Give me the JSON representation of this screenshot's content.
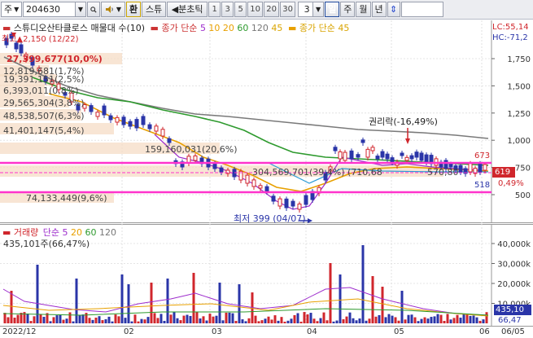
{
  "toolbar": {
    "market": "주",
    "code": "204630",
    "btn_unit": "환",
    "btn_stock": "스튜",
    "btn_minute": "◀분초틱",
    "periods": [
      "1",
      "3",
      "5",
      "10",
      "20",
      "30"
    ],
    "count": "3",
    "btn_day": "일",
    "btn_week": "주",
    "btn_month": "월",
    "btn_year": "년"
  },
  "main_legend": {
    "title": "스튜디오산타클로스 매물대 수(10)",
    "ma_label": "종가 단순",
    "ma_periods": [
      "5",
      "10",
      "20",
      "60",
      "120",
      "45"
    ],
    "ma_colors": [
      "#9d2ccc",
      "#e8a000",
      "#e8a000",
      "#2e9a2e",
      "#777777",
      "#d9a400"
    ],
    "extra_label": "종가 단순 45",
    "lc": "LC:55,14",
    "hc": "HC:-71,2"
  },
  "price_labels": {
    "high": "▲2,150 (12/22)",
    "high_prefix": "최고",
    "low": "최저 399 (04/07)",
    "rights": "권리락(-16,49%)",
    "current": "619",
    "current_pct": "0,49%",
    "band_top": "673",
    "band_bottom": "518"
  },
  "price_ticks": [
    "1,750",
    "1,500",
    "1,250",
    "1,000",
    "750",
    "500"
  ],
  "volume_profile": [
    {
      "text": "27,399,677(10,0%)"
    },
    {
      "text": "12,819,681(1,7%)"
    },
    {
      "text": "19,391,151(2,5%)"
    },
    {
      "text": "6,393,011(0,8%)"
    },
    {
      "text": "29,565,304(3,8%)"
    },
    {
      "text": "48,538,507(6,3%)"
    },
    {
      "text": "41,401,147(5,4%)"
    },
    {
      "text": "159,160,031(20,6%)"
    },
    {
      "text": "304,569,701(39,4%)"
    },
    {
      "text": "74,133,449(9,6%)"
    }
  ],
  "volume_profile_extra": [
    "(710,68",
    "570,80"
  ],
  "volume_legend": {
    "name": "거래량",
    "ma_label": "단순",
    "ma_periods": [
      "5",
      "20",
      "60",
      "120"
    ],
    "current": "435,101주(66,47%)",
    "right_value": "435,10",
    "right_pct": "66,47"
  },
  "volume_ticks": [
    "40,000k",
    "30,000k",
    "20,000k",
    "10,000k"
  ],
  "x_labels": [
    "2022/12",
    "02",
    "03",
    "04",
    "05",
    "06",
    "06/05"
  ],
  "colors": {
    "up": "#d0262c",
    "down": "#2a35a8",
    "band": "#ff33cc",
    "profile": "#f6dcc5"
  }
}
